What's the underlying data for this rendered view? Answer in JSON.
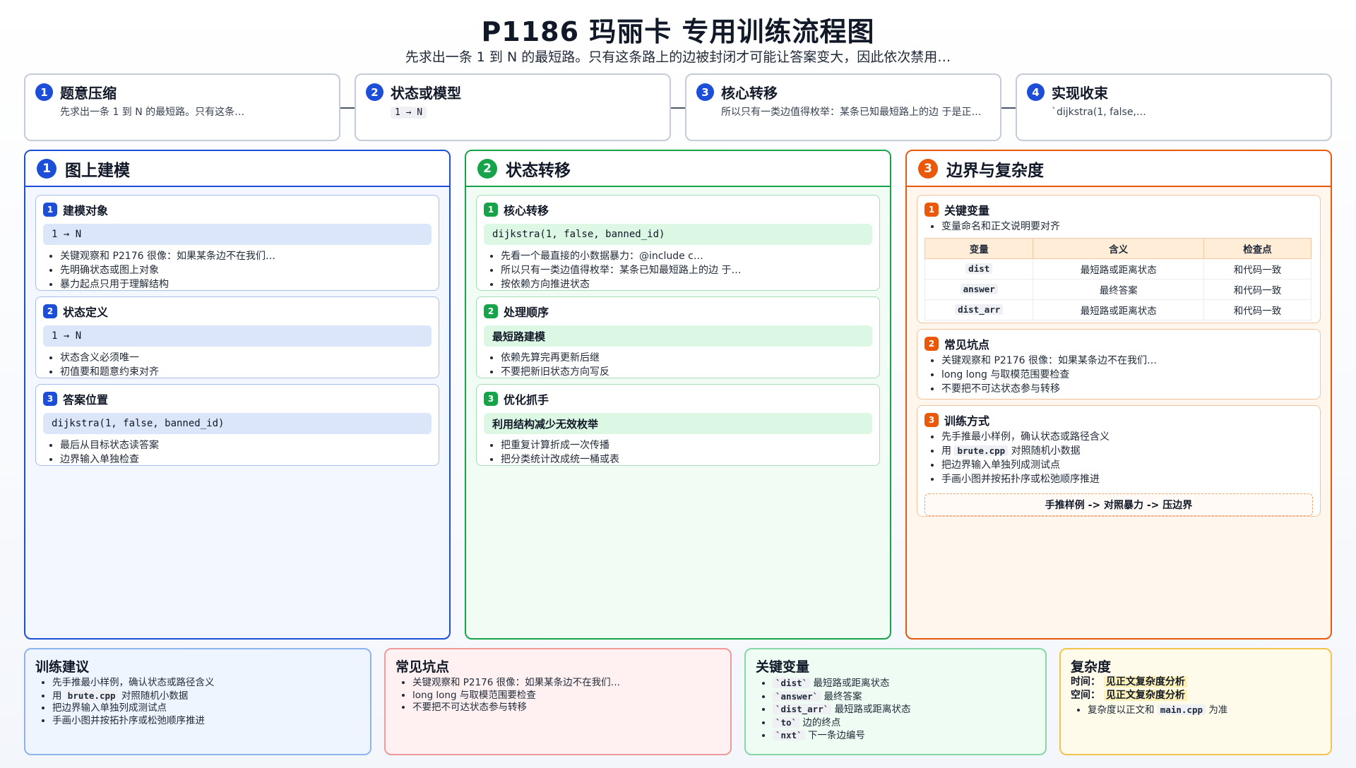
{
  "header": {
    "title": "P1186 玛丽卡 专用训练流程图",
    "subtitle": "先求出一条 1 到 N 的最短路。只有这条路上的边被封闭才可能让答案变大，因此依次禁用…"
  },
  "flow": [
    {
      "num": "1",
      "title": "题意压缩",
      "desc": "先求出一条 1 到 N 的最短路。只有这条…"
    },
    {
      "num": "2",
      "title": "状态或模型",
      "code": "1 → N"
    },
    {
      "num": "3",
      "title": "核心转移",
      "desc": "所以只有一类边值得枚举：某条已知最短路上的边 于是正…"
    },
    {
      "num": "4",
      "title": "实现收束",
      "desc": "`dijkstra(1, false,…"
    }
  ],
  "columns": {
    "c1": {
      "num": "1",
      "title": "图上建模",
      "cards": [
        {
          "num": "1",
          "title": "建模对象",
          "code": "1 → N",
          "bullets": [
            "关键观察和 P2176 很像：如果某条边不在我们…",
            "先明确状态或图上对象",
            "暴力起点只用于理解结构"
          ]
        },
        {
          "num": "2",
          "title": "状态定义",
          "code": "1 → N",
          "bullets": [
            "状态含义必须唯一",
            "初值要和题意约束对齐"
          ]
        },
        {
          "num": "3",
          "title": "答案位置",
          "code": "dijkstra(1, false, banned_id)",
          "bullets": [
            "最后从目标状态读答案",
            "边界输入单独检查"
          ]
        }
      ]
    },
    "c2": {
      "num": "2",
      "title": "状态转移",
      "cards": [
        {
          "num": "1",
          "title": "核心转移",
          "code": "dijkstra(1, false, banned_id)",
          "bullets": [
            "先看一个最直接的小数据暴力：@include c…",
            "所以只有一类边值得枚举：某条已知最短路上的边 于…",
            "按依赖方向推进状态"
          ]
        },
        {
          "num": "2",
          "title": "处理顺序",
          "bar": "最短路建模",
          "bullets": [
            "依赖先算完再更新后继",
            "不要把新旧状态方向写反"
          ]
        },
        {
          "num": "3",
          "title": "优化抓手",
          "bar": "利用结构减少无效枚举",
          "bullets": [
            "把重复计算折成一次传播",
            "把分类统计改成统一桶或表"
          ]
        }
      ]
    },
    "c3": {
      "num": "3",
      "title": "边界与复杂度",
      "vars": {
        "num": "1",
        "title": "关键变量",
        "bullet": "变量命名和正文说明要对齐",
        "headers": [
          "变量",
          "含义",
          "检查点"
        ],
        "rows": [
          [
            "dist",
            "最短路或距离状态",
            "和代码一致"
          ],
          [
            "answer",
            "最终答案",
            "和代码一致"
          ],
          [
            "dist_arr",
            "最短路或距离状态",
            "和代码一致"
          ]
        ]
      },
      "pitfalls": {
        "num": "2",
        "title": "常见坑点",
        "bullets": [
          "关键观察和 P2176 很像：如果某条边不在我们…",
          "long long 与取模范围要检查",
          "不要把不可达状态参与转移"
        ]
      },
      "training": {
        "num": "3",
        "title": "训练方式",
        "b1": "先手推最小样例，确认状态或路径含义",
        "b2_pre": "用",
        "b2_code": "brute.cpp",
        "b2_post": "对照随机小数据",
        "b3": "把边界输入单独列成测试点",
        "b4": "手画小图并按拓扑序或松弛顺序推进",
        "flow": "手推样例 -> 对照暴力 -> 压边界"
      }
    }
  },
  "bottom": {
    "advice": {
      "title": "训练建议",
      "b1": "先手推最小样例，确认状态或路径含义",
      "b2_pre": "用",
      "b2_code": "brute.cpp",
      "b2_post": "对照随机小数据",
      "b3": "把边界输入单独列成测试点",
      "b4": "手画小图并按拓扑序或松弛顺序推进"
    },
    "pitfalls": {
      "title": "常见坑点",
      "bullets": [
        "关键观察和 P2176 很像：如果某条边不在我们…",
        "long long 与取模范围要检查",
        "不要把不可达状态参与转移"
      ]
    },
    "vars": {
      "title": "关键变量",
      "items": [
        {
          "code": "`dist`",
          "text": "最短路或距离状态"
        },
        {
          "code": "`answer`",
          "text": "最终答案"
        },
        {
          "code": "`dist_arr`",
          "text": "最短路或距离状态"
        },
        {
          "code": "`to`",
          "text": "边的终点"
        },
        {
          "code": "`nxt`",
          "text": "下一条边编号"
        }
      ]
    },
    "complexity": {
      "title": "复杂度",
      "time_label": "时间：",
      "time_value": "见正文复杂度分析",
      "space_label": "空间：",
      "space_value": "见正文复杂度分析",
      "note_pre": "复杂度以正文和",
      "note_code": "main.cpp",
      "note_post": "为准"
    }
  }
}
